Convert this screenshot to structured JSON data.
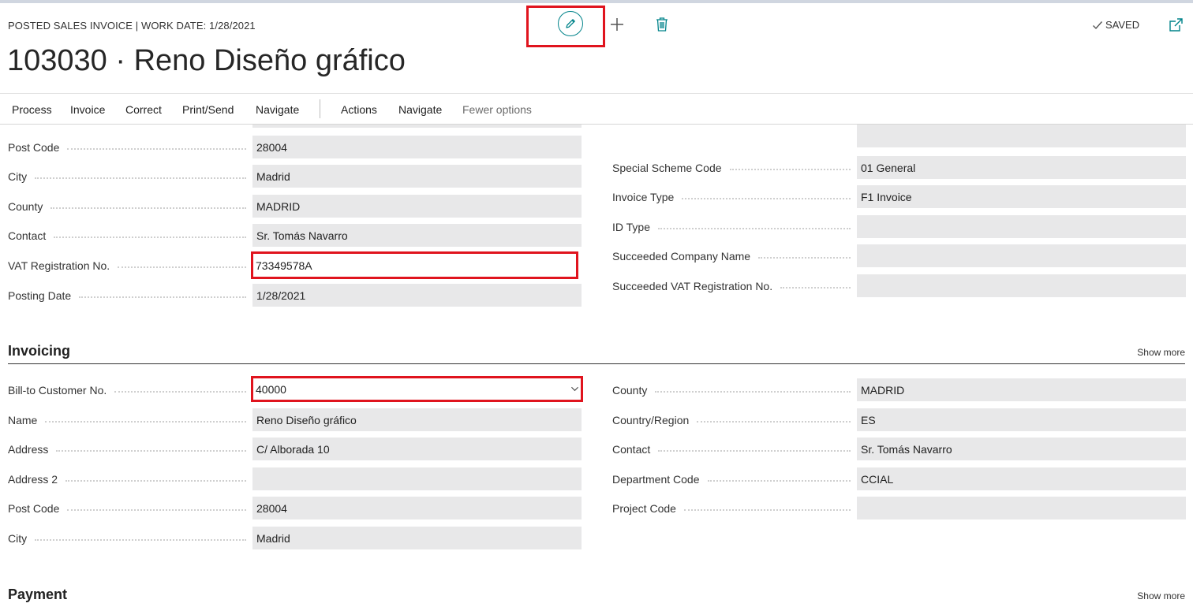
{
  "header": {
    "caption": "POSTED SALES INVOICE | WORK DATE: 1/28/2021",
    "title": "103030 · Reno Diseño gráfico",
    "saved_label": "SAVED"
  },
  "icons": {
    "edit": "pencil-icon",
    "new": "plus-icon",
    "delete": "trash-icon",
    "saved": "checkmark-icon",
    "popout": "open-in-new-window-icon",
    "dropdown": "chevron-down-icon"
  },
  "colors": {
    "accent": "#00838a",
    "highlight": "#e0141e",
    "field_bg": "#e8e8e9"
  },
  "actionbar": {
    "items": [
      "Process",
      "Invoice",
      "Correct",
      "Print/Send",
      "Navigate",
      "Actions",
      "Navigate",
      "Fewer options"
    ]
  },
  "general": {
    "left": [
      {
        "label": "Post Code",
        "value": "28004"
      },
      {
        "label": "City",
        "value": "Madrid"
      },
      {
        "label": "County",
        "value": "MADRID"
      },
      {
        "label": "Contact",
        "value": "Sr. Tomás Navarro"
      },
      {
        "label": "VAT Registration No.",
        "value": "73349578A"
      },
      {
        "label": "Posting Date",
        "value": "1/28/2021"
      }
    ],
    "right": [
      {
        "label": "Special Scheme Code",
        "value": "01 General"
      },
      {
        "label": "Invoice Type",
        "value": "F1 Invoice"
      },
      {
        "label": "ID Type",
        "value": ""
      },
      {
        "label": "Succeeded Company Name",
        "value": ""
      },
      {
        "label": "Succeeded VAT Registration No.",
        "value": ""
      }
    ]
  },
  "invoicing": {
    "title": "Invoicing",
    "show_more": "Show more",
    "left": [
      {
        "label": "Bill-to Customer No.",
        "value": "40000"
      },
      {
        "label": "Name",
        "value": "Reno Diseño gráfico"
      },
      {
        "label": "Address",
        "value": "C/ Alborada 10"
      },
      {
        "label": "Address 2",
        "value": ""
      },
      {
        "label": "Post Code",
        "value": "28004"
      },
      {
        "label": "City",
        "value": "Madrid"
      }
    ],
    "right": [
      {
        "label": "County",
        "value": "MADRID"
      },
      {
        "label": "Country/Region",
        "value": "ES"
      },
      {
        "label": "Contact",
        "value": "Sr. Tomás Navarro"
      },
      {
        "label": "Department Code",
        "value": "CCIAL"
      },
      {
        "label": "Project Code",
        "value": ""
      }
    ]
  },
  "payment": {
    "title": "Payment",
    "show_more": "Show more"
  }
}
